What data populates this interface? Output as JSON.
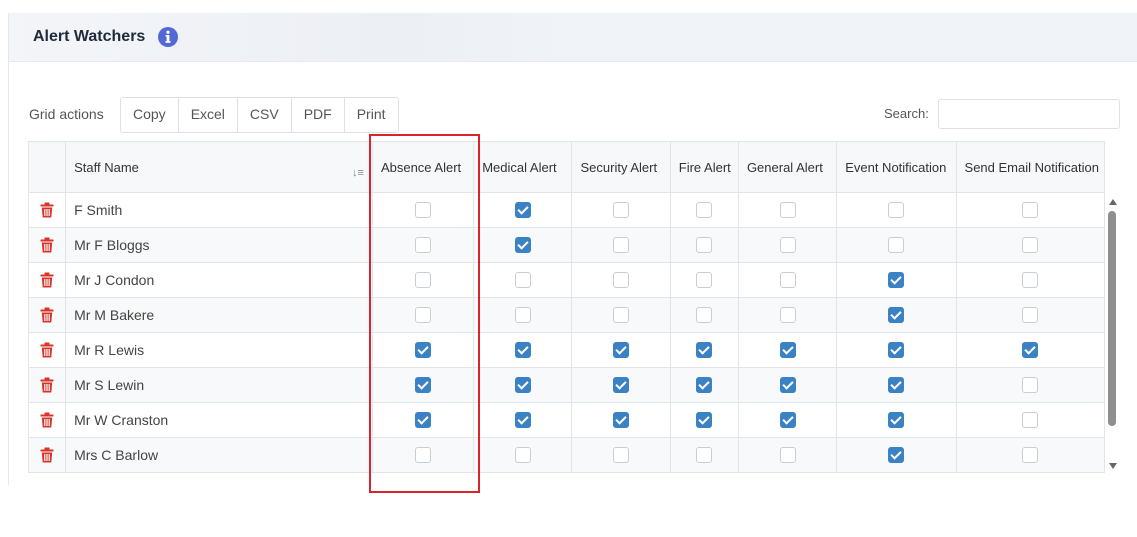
{
  "panel": {
    "title": "Alert Watchers",
    "info_icon": "info-circle-icon"
  },
  "toolbar": {
    "label": "Grid actions",
    "buttons": [
      "Copy",
      "Excel",
      "CSV",
      "PDF",
      "Print"
    ],
    "search_label": "Search:",
    "search_value": ""
  },
  "grid": {
    "columns": [
      "",
      "Staff Name",
      "Absence Alert",
      "Medical Alert",
      "Security Alert",
      "Fire Alert",
      "General Alert",
      "Event Notification",
      "Send Email Notification"
    ],
    "rows": [
      {
        "name": "F Smith",
        "checks": [
          false,
          true,
          false,
          false,
          false,
          false,
          false
        ]
      },
      {
        "name": "Mr F Bloggs",
        "checks": [
          false,
          true,
          false,
          false,
          false,
          false,
          false
        ]
      },
      {
        "name": "Mr J Condon",
        "checks": [
          false,
          false,
          false,
          false,
          false,
          true,
          false
        ]
      },
      {
        "name": "Mr M Bakere",
        "checks": [
          false,
          false,
          false,
          false,
          false,
          true,
          false
        ]
      },
      {
        "name": "Mr R Lewis",
        "checks": [
          true,
          true,
          true,
          true,
          true,
          true,
          true
        ]
      },
      {
        "name": "Mr S Lewin",
        "checks": [
          true,
          true,
          true,
          true,
          true,
          true,
          false
        ]
      },
      {
        "name": "Mr W Cranston",
        "checks": [
          true,
          true,
          true,
          true,
          true,
          true,
          false
        ]
      },
      {
        "name": "Mrs C Barlow",
        "checks": [
          false,
          false,
          false,
          false,
          false,
          true,
          false
        ]
      }
    ]
  },
  "colors": {
    "accent": "#3b82c4",
    "delete": "#d9342b",
    "highlight": "#d9242b",
    "info": "#5468d4"
  }
}
